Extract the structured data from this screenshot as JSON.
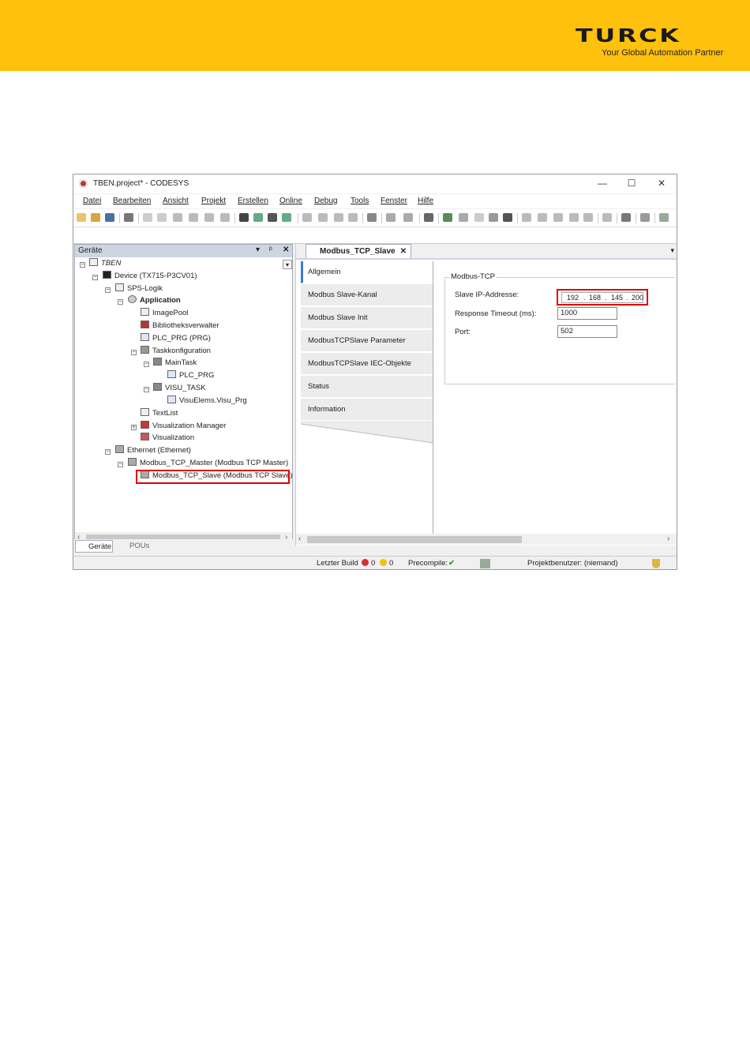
{
  "brand": {
    "logo": "TURCK",
    "tagline": "Your Global Automation Partner",
    "header_color": "#fec10e"
  },
  "window": {
    "title": "TBEN.project* - CODESYS",
    "controls": [
      "—",
      "☐",
      "✕"
    ]
  },
  "menu": [
    "Datei",
    "Bearbeiten",
    "Ansicht",
    "Projekt",
    "Erstellen",
    "Online",
    "Debug",
    "Tools",
    "Fenster",
    "Hilfe"
  ],
  "devices": {
    "title": "Geräte",
    "tree": [
      {
        "label": "TBEN",
        "italic": true,
        "icon": "project-icon"
      },
      {
        "label": "Device (TX715-P3CV01)",
        "icon": "device-icon"
      },
      {
        "label": "SPS-Logik",
        "icon": "plc-logic-icon"
      },
      {
        "label": "Application",
        "bold": true,
        "icon": "application-icon"
      },
      {
        "label": "ImagePool",
        "icon": "imagepool-icon"
      },
      {
        "label": "Bibliotheksverwalter",
        "icon": "library-icon"
      },
      {
        "label": "PLC_PRG (PRG)",
        "icon": "prg-icon"
      },
      {
        "label": "Taskkonfiguration",
        "icon": "task-config-icon"
      },
      {
        "label": "MainTask",
        "icon": "task-icon"
      },
      {
        "label": "PLC_PRG",
        "icon": "prg-icon"
      },
      {
        "label": "VISU_TASK",
        "icon": "task-icon"
      },
      {
        "label": "VisuElems.Visu_Prg",
        "icon": "prg-icon"
      },
      {
        "label": "TextList",
        "icon": "textlist-icon"
      },
      {
        "label": "Visualization Manager",
        "icon": "visu-manager-icon"
      },
      {
        "label": "Visualization",
        "icon": "visualization-icon"
      },
      {
        "label": "Ethernet (Ethernet)",
        "icon": "ethernet-icon"
      },
      {
        "label": "Modbus_TCP_Master (Modbus TCP Master)",
        "icon": "modbus-master-icon"
      },
      {
        "label": "Modbus_TCP_Slave (Modbus TCP Slave)",
        "icon": "modbus-slave-icon"
      }
    ],
    "tabs": [
      "Geräte",
      "POUs"
    ]
  },
  "editor": {
    "tab_label": "Modbus_TCP_Slave",
    "side_tabs": [
      "Allgemein",
      "Modbus Slave-Kanal",
      "Modbus Slave Init",
      "ModbusTCPSlave Parameter",
      "ModbusTCPSlave IEC-Objekte",
      "Status",
      "Information"
    ],
    "group_label": "Modbus-TCP",
    "ip_label": "Slave IP-Addresse:",
    "ip": [
      "192",
      "168",
      "145",
      "200"
    ],
    "timeout_label": "Response Timeout (ms):",
    "timeout_value": "1000",
    "port_label": "Port:",
    "port_value": "502"
  },
  "status": {
    "build_label": "Letzter Build",
    "errors": "0",
    "warnings": "0",
    "precompile_label": "Precompile:",
    "user": "Projektbenutzer: (niemand)"
  }
}
